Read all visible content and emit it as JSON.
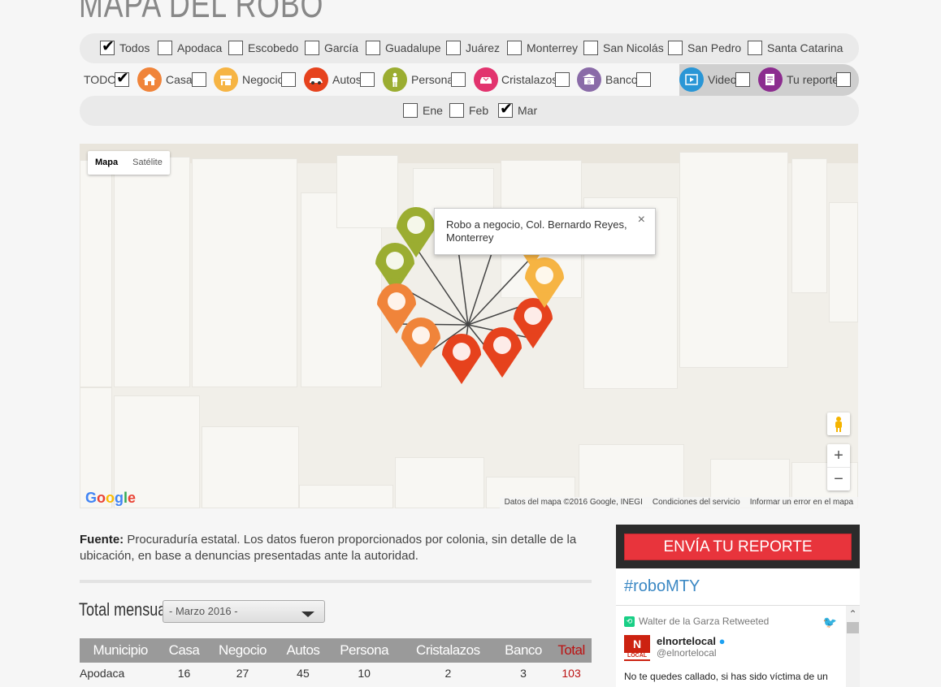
{
  "title": "MAPA DEL ROBO",
  "municipalities": [
    {
      "label": "Todos",
      "checked": true
    },
    {
      "label": "Apodaca",
      "checked": false
    },
    {
      "label": "Escobedo",
      "checked": false
    },
    {
      "label": "García",
      "checked": false
    },
    {
      "label": "Guadalupe",
      "checked": false
    },
    {
      "label": "Juárez",
      "checked": false
    },
    {
      "label": "Monterrey",
      "checked": false
    },
    {
      "label": "San Nicolás",
      "checked": false
    },
    {
      "label": "San Pedro",
      "checked": false
    },
    {
      "label": "Santa Catarina",
      "checked": false
    }
  ],
  "categories": {
    "todo_label": "TODO",
    "todo_checked": true,
    "items": [
      {
        "label": "Casa",
        "icon": "house-icon",
        "color": "#f0843a"
      },
      {
        "label": "Negocio",
        "icon": "store-icon",
        "color": "#f6b443"
      },
      {
        "label": "Autos",
        "icon": "car-icon",
        "color": "#e6421d"
      },
      {
        "label": "Persona",
        "icon": "person-icon",
        "color": "#9bad31"
      },
      {
        "label": "Cristalazos",
        "icon": "broken-window-icon",
        "color": "#e2336e"
      },
      {
        "label": "Banco",
        "icon": "bank-icon",
        "color": "#8a6ba8"
      },
      {
        "label": "Video",
        "icon": "video-icon",
        "color": "#2996d6"
      },
      {
        "label": "Tu reporte",
        "icon": "report-icon",
        "color": "#8c2c8f"
      }
    ]
  },
  "months": [
    {
      "label": "Ene",
      "checked": false
    },
    {
      "label": "Feb",
      "checked": false
    },
    {
      "label": "Mar",
      "checked": true
    }
  ],
  "map": {
    "type_buttons": [
      "Mapa",
      "Satélite"
    ],
    "info_text": "Robo a negocio, Col. Bernardo Reyes, Monterrey",
    "close_symbol": "×",
    "google_logo": "Google",
    "footer": [
      "Datos del mapa ©2016 Google, INEGI",
      "Condiciones del servicio",
      "Informar un error en el mapa"
    ],
    "zoom_in": "+",
    "zoom_out": "−"
  },
  "source": {
    "label": "Fuente:",
    "text": " Procuraduría estatal. Los datos fueron proporcionados por colonia, sin detalle de la ubicación, en base a denuncias presentadas ante la autoridad."
  },
  "monthly": {
    "label": "Total mensual",
    "selected": "- Marzo 2016 -"
  },
  "table": {
    "headers": [
      "Municipio",
      "Casa",
      "Negocio",
      "Autos",
      "Persona",
      "Cristalazos",
      "Banco",
      "Total"
    ],
    "rows": [
      [
        "Apodaca",
        "16",
        "27",
        "45",
        "10",
        "2",
        "3",
        "103"
      ]
    ]
  },
  "report": {
    "button": "ENVÍA TU REPORTE",
    "hashtag": "#roboMTY",
    "tweet": {
      "retweeted_by": "Walter de la Garza Retweeted",
      "name": "elnortelocal",
      "handle": "@elnortelocal",
      "avatar_text": "N",
      "avatar_sub": "LOCAL",
      "text": "No te quedes callado, si has sido víctima de un"
    }
  }
}
